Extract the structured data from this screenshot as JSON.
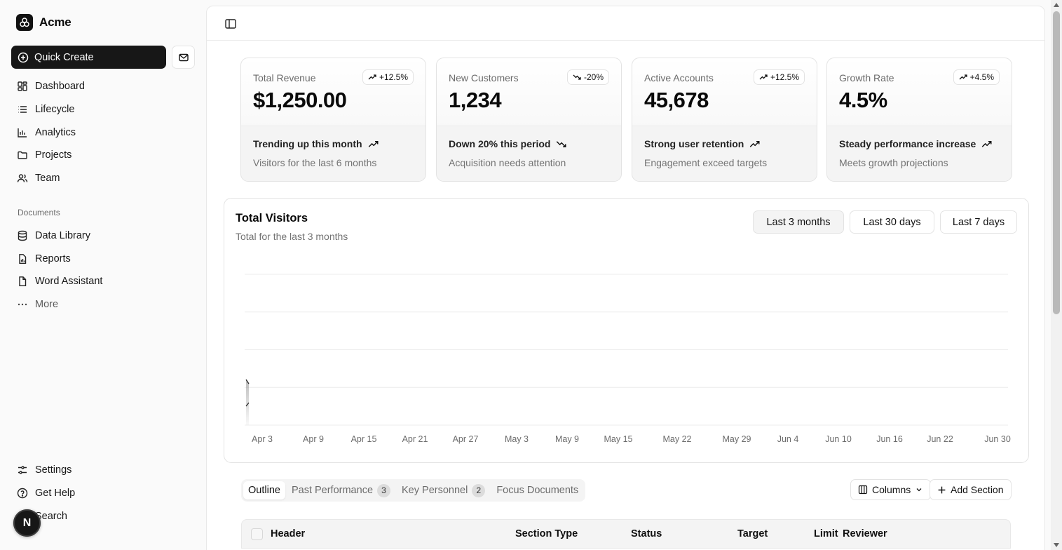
{
  "app": {
    "name": "Acme"
  },
  "sidebar": {
    "quick_create": "Quick Create",
    "primary_nav": [
      {
        "label": "Dashboard",
        "icon": "dashboard-icon"
      },
      {
        "label": "Lifecycle",
        "icon": "list-icon"
      },
      {
        "label": "Analytics",
        "icon": "chart-icon"
      },
      {
        "label": "Projects",
        "icon": "folder-icon"
      },
      {
        "label": "Team",
        "icon": "users-icon"
      }
    ],
    "documents_label": "Documents",
    "documents_nav": [
      {
        "label": "Data Library",
        "icon": "database-icon"
      },
      {
        "label": "Reports",
        "icon": "report-icon"
      },
      {
        "label": "Word Assistant",
        "icon": "file-icon"
      },
      {
        "label": "More",
        "icon": "more-icon"
      }
    ],
    "secondary_nav": [
      {
        "label": "Settings",
        "icon": "settings-icon"
      },
      {
        "label": "Get Help",
        "icon": "help-icon"
      },
      {
        "label": "Search",
        "icon": "search-icon"
      }
    ],
    "avatar_initial": "N"
  },
  "cards": [
    {
      "label": "Total Revenue",
      "badge": "+12.5%",
      "badge_dir": "up",
      "value": "$1,250.00",
      "trend": "Trending up this month",
      "trend_dir": "up",
      "sub": "Visitors for the last 6 months"
    },
    {
      "label": "New Customers",
      "badge": "-20%",
      "badge_dir": "down",
      "value": "1,234",
      "trend": "Down 20% this period",
      "trend_dir": "down",
      "sub": "Acquisition needs attention"
    },
    {
      "label": "Active Accounts",
      "badge": "+12.5%",
      "badge_dir": "up",
      "value": "45,678",
      "trend": "Strong user retention",
      "trend_dir": "up",
      "sub": "Engagement exceed targets"
    },
    {
      "label": "Growth Rate",
      "badge": "+4.5%",
      "badge_dir": "up",
      "value": "4.5%",
      "trend": "Steady performance increase",
      "trend_dir": "up",
      "sub": "Meets growth projections"
    }
  ],
  "visitors": {
    "title": "Total Visitors",
    "subtitle": "Total for the last 3 months",
    "ranges": [
      "Last 3 months",
      "Last 30 days",
      "Last 7 days"
    ],
    "active_range": "Last 3 months"
  },
  "chart_data": {
    "type": "area",
    "x_ticks": [
      "Apr 3",
      "Apr 9",
      "Apr 15",
      "Apr 21",
      "Apr 27",
      "May 3",
      "May 9",
      "May 15",
      "May 22",
      "May 29",
      "Jun 4",
      "Jun 10",
      "Jun 16",
      "Jun 22",
      "Jun 30"
    ],
    "grid": true,
    "grid_lines": 5,
    "series": []
  },
  "table": {
    "tabs": [
      {
        "label": "Outline",
        "count": ""
      },
      {
        "label": "Past Performance",
        "count": "3"
      },
      {
        "label": "Key Personnel",
        "count": "2"
      },
      {
        "label": "Focus Documents",
        "count": ""
      }
    ],
    "columns_button": "Columns",
    "add_section_button": "Add Section",
    "headers": [
      "Header",
      "Section Type",
      "Status",
      "Target",
      "Limit",
      "Reviewer"
    ]
  }
}
